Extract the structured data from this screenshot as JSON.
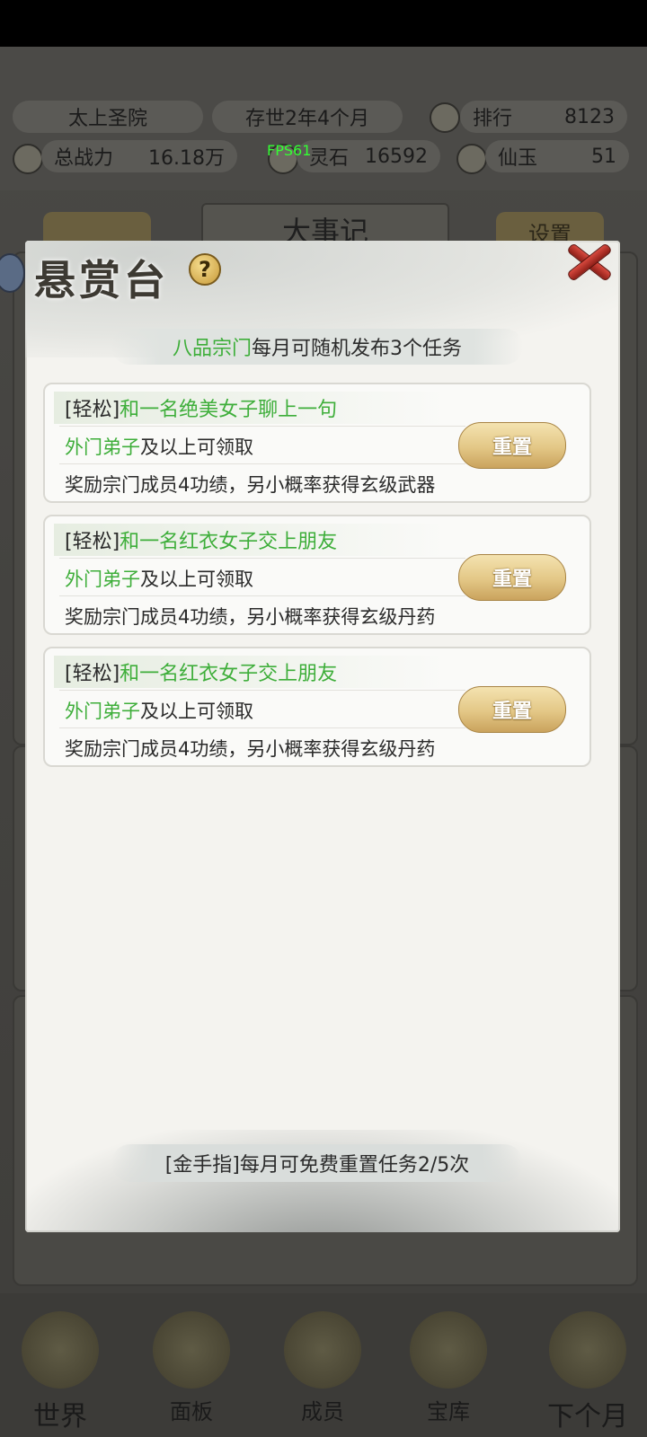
{
  "background": {
    "sect_name": "太上圣院",
    "duration": "存世2年4个月",
    "rank_label": "排行",
    "rank_value": "8123",
    "power_label": "总战力",
    "power_value": "16.18万",
    "fps": "FPS61",
    "stone_label": "灵石",
    "stone_value": "16592",
    "jade_label": "仙玉",
    "jade_value": "51",
    "events_title": "大事记",
    "settings_label": "设置",
    "nav": [
      {
        "label": "世界",
        "icon": "world-icon"
      },
      {
        "label": "面板",
        "icon": "panel-icon"
      },
      {
        "label": "成员",
        "icon": "member-icon"
      },
      {
        "label": "宝库",
        "icon": "treasury-icon"
      },
      {
        "label": "下个月",
        "icon": "next-month-icon"
      }
    ]
  },
  "modal": {
    "title": "悬赏台",
    "help_icon": "?",
    "info_highlight": "八品宗门",
    "info_text": "每月可随机发布3个任务",
    "tasks": [
      {
        "difficulty": "[轻松]",
        "name": "和一名绝美女子聊上一句",
        "rank_req": "外门弟子",
        "rank_suffix": "及以上可领取",
        "reward": "奖励宗门成员4功绩，另小概率获得玄级武器",
        "button": "重置"
      },
      {
        "difficulty": "[轻松]",
        "name": "和一名红衣女子交上朋友",
        "rank_req": "外门弟子",
        "rank_suffix": "及以上可领取",
        "reward": "奖励宗门成员4功绩，另小概率获得玄级丹药",
        "button": "重置"
      },
      {
        "difficulty": "[轻松]",
        "name": "和一名红衣女子交上朋友",
        "rank_req": "外门弟子",
        "rank_suffix": "及以上可领取",
        "reward": "奖励宗门成员4功绩，另小概率获得玄级丹药",
        "button": "重置"
      }
    ],
    "footer": "[金手指]每月可免费重置任务2/5次"
  },
  "colors": {
    "accent_green": "#3eae3a",
    "button_gold": "#e3c786",
    "close_red": "#c23a30"
  }
}
